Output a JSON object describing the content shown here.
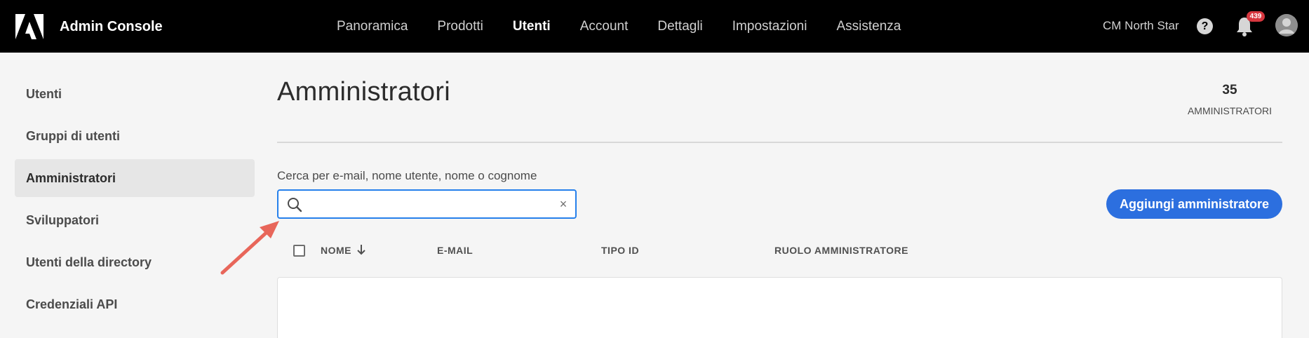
{
  "app": {
    "title": "Admin Console"
  },
  "nav": {
    "items": [
      {
        "label": "Panoramica",
        "active": false
      },
      {
        "label": "Prodotti",
        "active": false
      },
      {
        "label": "Utenti",
        "active": true
      },
      {
        "label": "Account",
        "active": false
      },
      {
        "label": "Dettagli",
        "active": false
      },
      {
        "label": "Impostazioni",
        "active": false
      },
      {
        "label": "Assistenza",
        "active": false
      }
    ]
  },
  "header": {
    "org_name": "CM North Star",
    "help_glyph": "?",
    "notification_count": "439"
  },
  "sidebar": {
    "items": [
      {
        "label": "Utenti",
        "active": false
      },
      {
        "label": "Gruppi di utenti",
        "active": false
      },
      {
        "label": "Amministratori",
        "active": true
      },
      {
        "label": "Sviluppatori",
        "active": false
      },
      {
        "label": "Utenti della directory",
        "active": false
      },
      {
        "label": "Credenziali API",
        "active": false
      }
    ]
  },
  "main": {
    "title": "Amministratori",
    "count": "35",
    "count_label": "AMMINISTRATORI",
    "search": {
      "label": "Cerca per e-mail, nome utente, nome o cognome",
      "value": "",
      "placeholder": "",
      "clear_glyph": "×"
    },
    "add_button_label": "Aggiungi amministratore",
    "table": {
      "columns": [
        "NOME",
        "E-MAIL",
        "TIPO ID",
        "RUOLO AMMINISTRATORE"
      ],
      "sorted_column": "NOME",
      "sort_direction": "descending"
    }
  },
  "colors": {
    "topbar_bg": "#000000",
    "accent": "#2c6fdf",
    "focus_border": "#2680eb",
    "badge": "#d7373f",
    "annotation_arrow": "#e8665a"
  },
  "icons": {
    "logo": "adobe-logo",
    "help": "help-circle-icon",
    "notifications": "bell-icon",
    "avatar": "user-avatar",
    "search": "search-icon",
    "clear": "close-icon",
    "sort": "arrow-down-icon",
    "annotation": "arrow-icon"
  }
}
